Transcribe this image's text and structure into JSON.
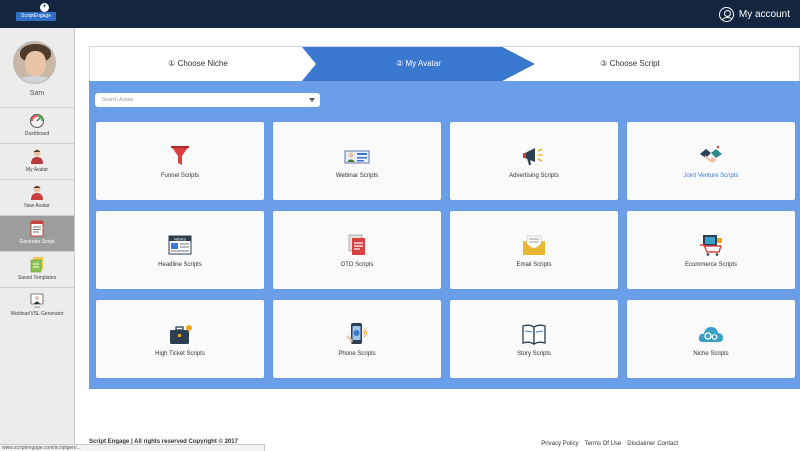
{
  "topbar": {
    "logo_text": "ScriptEngage",
    "account_label": "My account"
  },
  "sidebar": {
    "username": "Sam",
    "items": [
      {
        "label": "Dashboard",
        "icon": "gauge-icon"
      },
      {
        "label": "My Avatar",
        "icon": "person-icon"
      },
      {
        "label": "New Avatar",
        "icon": "person-add-icon"
      },
      {
        "label": "Generate Script",
        "icon": "document-icon"
      },
      {
        "label": "Saved Templates",
        "icon": "templates-icon"
      },
      {
        "label": "Webinar/VSL Generator",
        "icon": "video-icon"
      }
    ]
  },
  "stepper": {
    "steps": [
      {
        "label": "① Choose Niche"
      },
      {
        "label": "② My Avatar"
      },
      {
        "label": "③ Choose Script"
      }
    ]
  },
  "search": {
    "placeholder": "Search Avatar"
  },
  "cards": [
    {
      "label": "Funnel Scripts",
      "icon": "funnel-icon"
    },
    {
      "label": "Webinar Scripts",
      "icon": "webinar-icon"
    },
    {
      "label": "Advertising Scripts",
      "icon": "megaphone-icon"
    },
    {
      "label": "Joint Venture Scripts",
      "icon": "handshake-icon"
    },
    {
      "label": "Headline Scripts",
      "icon": "newspaper-icon"
    },
    {
      "label": "OTO Scripts",
      "icon": "documents-icon"
    },
    {
      "label": "Email Scripts",
      "icon": "envelope-icon"
    },
    {
      "label": "Ecommerce Scripts",
      "icon": "cart-icon"
    },
    {
      "label": "High Ticket Scripts",
      "icon": "briefcase-icon"
    },
    {
      "label": "Phone Scripts",
      "icon": "phone-icon"
    },
    {
      "label": "Story Scripts",
      "icon": "book-icon"
    },
    {
      "label": "Niche Scripts",
      "icon": "cloud-gears-icon"
    }
  ],
  "footer": {
    "copyright": "Script Engage | All rights reserved Copyright © 2017",
    "links": [
      "Privacy Policy",
      "Terms Of Use",
      "Disclaimer",
      "Contact"
    ]
  },
  "statusbar": {
    "url": "www.scriptengage.com/scriptgen/..."
  },
  "colors": {
    "topbar": "#13253f",
    "accent": "#3a78d0",
    "panel": "#6b9ee8"
  }
}
